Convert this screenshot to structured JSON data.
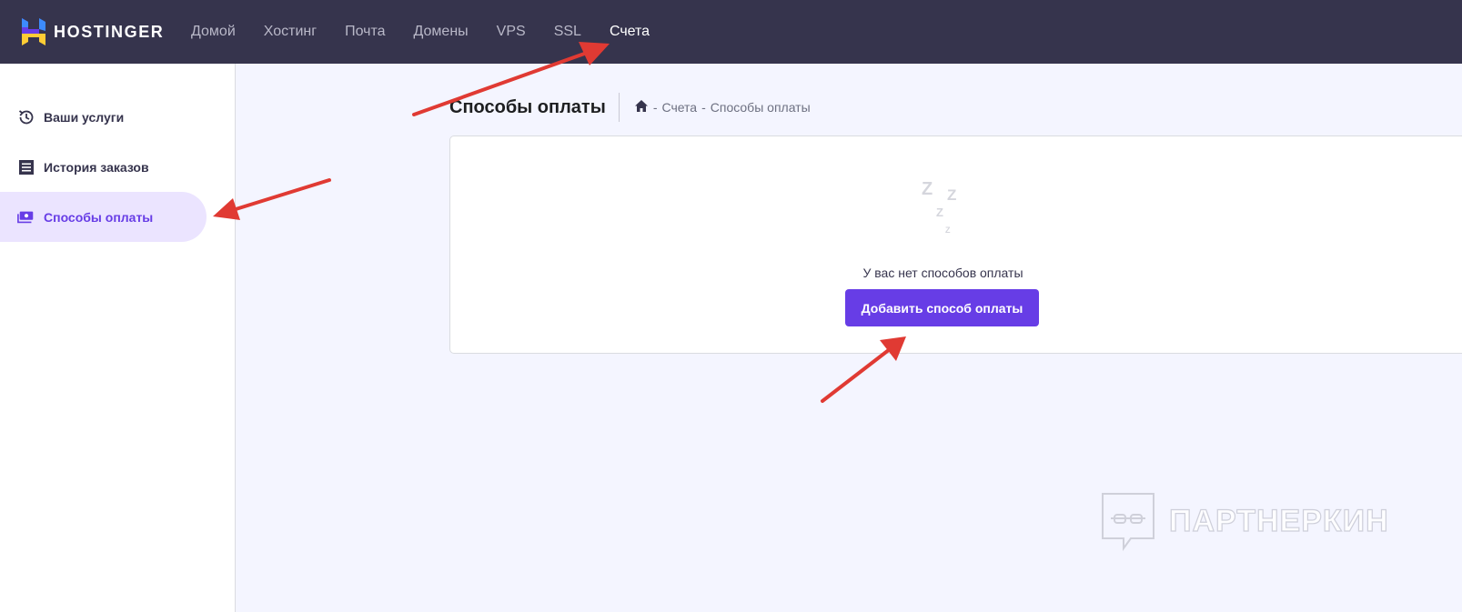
{
  "brand": {
    "name": "HOSTINGER"
  },
  "nav": {
    "items": [
      {
        "label": "Домой"
      },
      {
        "label": "Хостинг"
      },
      {
        "label": "Почта"
      },
      {
        "label": "Домены"
      },
      {
        "label": "VPS"
      },
      {
        "label": "SSL"
      },
      {
        "label": "Счета"
      }
    ],
    "active": "Счета"
  },
  "sidebar": {
    "items": [
      {
        "label": "Ваши услуги",
        "icon": "history-icon"
      },
      {
        "label": "История заказов",
        "icon": "receipt-icon"
      },
      {
        "label": "Способы оплаты",
        "icon": "payment-icon"
      }
    ],
    "active": "Способы оплаты"
  },
  "page": {
    "title": "Способы оплаты",
    "breadcrumb": [
      "Счета",
      "Способы оплаты"
    ],
    "breadcrumb_sep": "-"
  },
  "empty_state": {
    "message": "У вас нет способов оплаты",
    "button_label": "Добавить способ оплаты",
    "icon": "sleep-zzz-icon"
  },
  "watermark": {
    "text": "ПАРТНЕРКИН"
  },
  "colors": {
    "topbar": "#36344d",
    "accent": "#673de6",
    "sidebar_active_bg": "#ebe4ff",
    "main_bg": "#f4f5ff",
    "arrow": "#e03a33"
  }
}
